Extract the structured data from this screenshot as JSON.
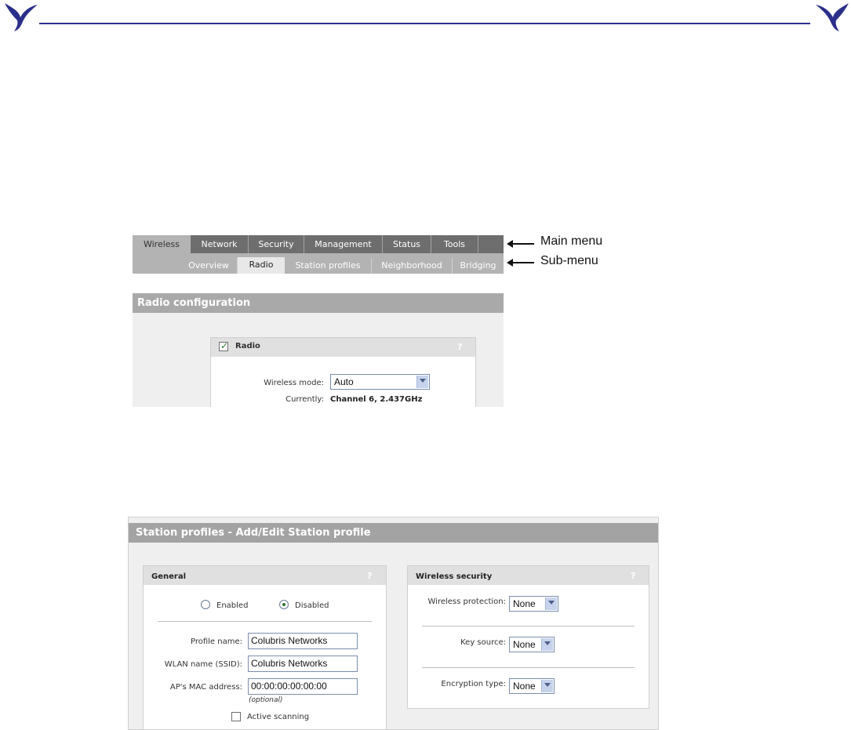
{
  "colors": {
    "header_rule": "#2a2f8a",
    "main_menu_bg": "#6e6e6e",
    "submenu_bg": "#b3b3b3",
    "title_bar_bg": "#a3a3a3"
  },
  "header": {
    "logo_icon": "swift-bird-logo"
  },
  "figure1": {
    "main_menu": [
      "Wireless",
      "Network",
      "Security",
      "Management",
      "Status",
      "Tools"
    ],
    "main_menu_active": "Wireless",
    "sub_menu": [
      "Overview",
      "Radio",
      "Station profiles",
      "Neighborhood",
      "Bridging"
    ],
    "sub_menu_active": "Radio",
    "page_title": "Radio configuration",
    "radio_panel": {
      "title": "Radio",
      "checked": true,
      "help": "?",
      "wireless_mode_label": "Wireless mode:",
      "wireless_mode_value": "Auto",
      "currently_label": "Currently:",
      "currently_value": "Channel 6, 2.437GHz"
    }
  },
  "callouts": {
    "main_menu": "Main menu",
    "sub_menu": "Sub-menu"
  },
  "figure2": {
    "page_title": "Station profiles - Add/Edit Station profile",
    "general": {
      "title": "General",
      "help": "?",
      "enabled_label": "Enabled",
      "disabled_label": "Disabled",
      "selected": "Disabled",
      "profile_name_label": "Profile name:",
      "profile_name_value": "Colubris Networks",
      "ssid_label": "WLAN name (SSID):",
      "ssid_value": "Colubris Networks",
      "mac_label": "AP's MAC address:",
      "mac_value": "00:00:00:00:00:00",
      "mac_hint": "(optional)",
      "active_scanning_label": "Active scanning",
      "active_scanning_checked": false
    },
    "security": {
      "title": "Wireless security",
      "help": "?",
      "protection_label": "Wireless protection:",
      "protection_value": "None",
      "key_source_label": "Key source:",
      "key_source_value": "None",
      "encryption_label": "Encryption type:",
      "encryption_value": "None"
    }
  }
}
